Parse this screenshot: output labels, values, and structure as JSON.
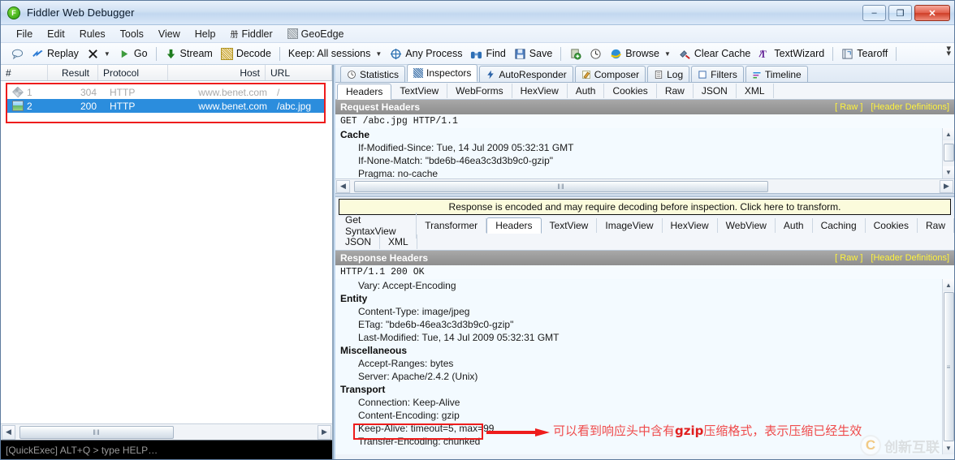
{
  "window": {
    "title": "Fiddler Web Debugger",
    "app_icon": "fiddler-icon",
    "minimize_glyph": "–",
    "restore_glyph": "❐",
    "close_glyph": "✕"
  },
  "menubar": {
    "items": [
      {
        "label": "File"
      },
      {
        "label": "Edit"
      },
      {
        "label": "Rules"
      },
      {
        "label": "Tools"
      },
      {
        "label": "View"
      },
      {
        "label": "Help"
      },
      {
        "label": "Fiddler",
        "glyph": "册"
      },
      {
        "label": "GeoEdge",
        "icon": "geoedge-icon"
      }
    ]
  },
  "toolbar": {
    "comment_label": "",
    "replay_label": "Replay",
    "remove_label": "",
    "go_label": "Go",
    "stream_label": "Stream",
    "decode_label": "Decode",
    "keep_label": "Keep: All sessions",
    "process_label": "Any Process",
    "find_label": "Find",
    "save_label": "Save",
    "browse_label": "Browse",
    "clearcache_label": "Clear Cache",
    "textwizard_label": "TextWizard",
    "tearoff_label": "Tearoff"
  },
  "sessions": {
    "columns": [
      "#",
      "Result",
      "Protocol",
      "Host",
      "URL"
    ],
    "rows": [
      {
        "icon": "protocol-diamond-icon",
        "num": "1",
        "result": "304",
        "protocol": "HTTP",
        "host": "www.benet.com",
        "url": "/",
        "selected": false
      },
      {
        "icon": "image-file-icon",
        "num": "2",
        "result": "200",
        "protocol": "HTTP",
        "host": "www.benet.com",
        "url": "/abc.jpg",
        "selected": true
      }
    ],
    "scroll_grip": "‖‖"
  },
  "quickexec": {
    "text": "[QuickExec] ALT+Q > type HELP…"
  },
  "inspector": {
    "main_tabs": [
      {
        "label": "Statistics",
        "icon": "clock-icon",
        "active": false
      },
      {
        "label": "Inspectors",
        "icon": "magnify-grid-icon",
        "active": true
      },
      {
        "label": "AutoResponder",
        "icon": "lightning-icon",
        "active": false
      },
      {
        "label": "Composer",
        "icon": "pencil-icon",
        "active": false
      },
      {
        "label": "Log",
        "icon": "list-icon",
        "active": false
      },
      {
        "label": "Filters",
        "icon": "square-icon",
        "active": false
      },
      {
        "label": "Timeline",
        "icon": "bars-icon",
        "active": false
      }
    ],
    "request_tabs": [
      {
        "label": "Headers",
        "active": true
      },
      {
        "label": "TextView",
        "active": false
      },
      {
        "label": "WebForms",
        "active": false
      },
      {
        "label": "HexView",
        "active": false
      },
      {
        "label": "Auth",
        "active": false
      },
      {
        "label": "Cookies",
        "active": false
      },
      {
        "label": "Raw",
        "active": false
      },
      {
        "label": "JSON",
        "active": false
      },
      {
        "label": "XML",
        "active": false
      }
    ],
    "request": {
      "section_title": "Request Headers",
      "raw_link": "[ Raw ]",
      "header_defs_link": "[Header Definitions]",
      "request_line": "GET /abc.jpg HTTP/1.1",
      "groups": [
        {
          "name": "Cache",
          "items": [
            "If-Modified-Since: Tue, 14 Jul 2009 05:32:31 GMT",
            "If-None-Match: \"bde6b-46ea3c3d3b9c0-gzip\"",
            "Pragma: no-cache"
          ]
        }
      ]
    },
    "notice": "Response is encoded and may require decoding before inspection. Click here to transform.",
    "response_tabs_row1": [
      {
        "label": "Get SyntaxView",
        "active": false
      },
      {
        "label": "Transformer",
        "active": false
      },
      {
        "label": "Headers",
        "active": true
      },
      {
        "label": "TextView",
        "active": false
      },
      {
        "label": "ImageView",
        "active": false
      },
      {
        "label": "HexView",
        "active": false
      },
      {
        "label": "WebView",
        "active": false
      },
      {
        "label": "Auth",
        "active": false
      },
      {
        "label": "Caching",
        "active": false
      },
      {
        "label": "Cookies",
        "active": false
      },
      {
        "label": "Raw",
        "active": false
      }
    ],
    "response_tabs_row2": [
      {
        "label": "JSON",
        "active": false
      },
      {
        "label": "XML",
        "active": false
      }
    ],
    "response": {
      "section_title": "Response Headers",
      "raw_link": "[ Raw ]",
      "header_defs_link": "[Header Definitions]",
      "status_line": "HTTP/1.1 200 OK",
      "leading_items": [
        "Vary: Accept-Encoding"
      ],
      "groups": [
        {
          "name": "Entity",
          "items": [
            "Content-Type: image/jpeg",
            "ETag: \"bde6b-46ea3c3d3b9c0-gzip\"",
            "Last-Modified: Tue, 14 Jul 2009 05:32:31 GMT"
          ]
        },
        {
          "name": "Miscellaneous",
          "items": [
            "Accept-Ranges: bytes",
            "Server: Apache/2.4.2 (Unix)"
          ]
        },
        {
          "name": "Transport",
          "items": [
            "Connection: Keep-Alive",
            "Content-Encoding: gzip",
            "Keep-Alive: timeout=5, max=99",
            "Transfer-Encoding: chunked"
          ]
        }
      ]
    }
  },
  "annotation": {
    "text_part1": "可以看到响应头中含有",
    "text_highlight": "gzip",
    "text_part2": "压缩格式，表示压缩已经生效",
    "box_color": "#ee1c1c",
    "text_color": "#ef4b4b"
  },
  "watermark": {
    "mark": "C",
    "text": "创新互联"
  },
  "colors": {
    "selection_blue": "#2b8ddd",
    "annotation_red": "#ee1c1c",
    "notice_yellow": "#fbfbdc",
    "section_gray": "#8e8e8e",
    "link_yellow": "#fff33c"
  }
}
